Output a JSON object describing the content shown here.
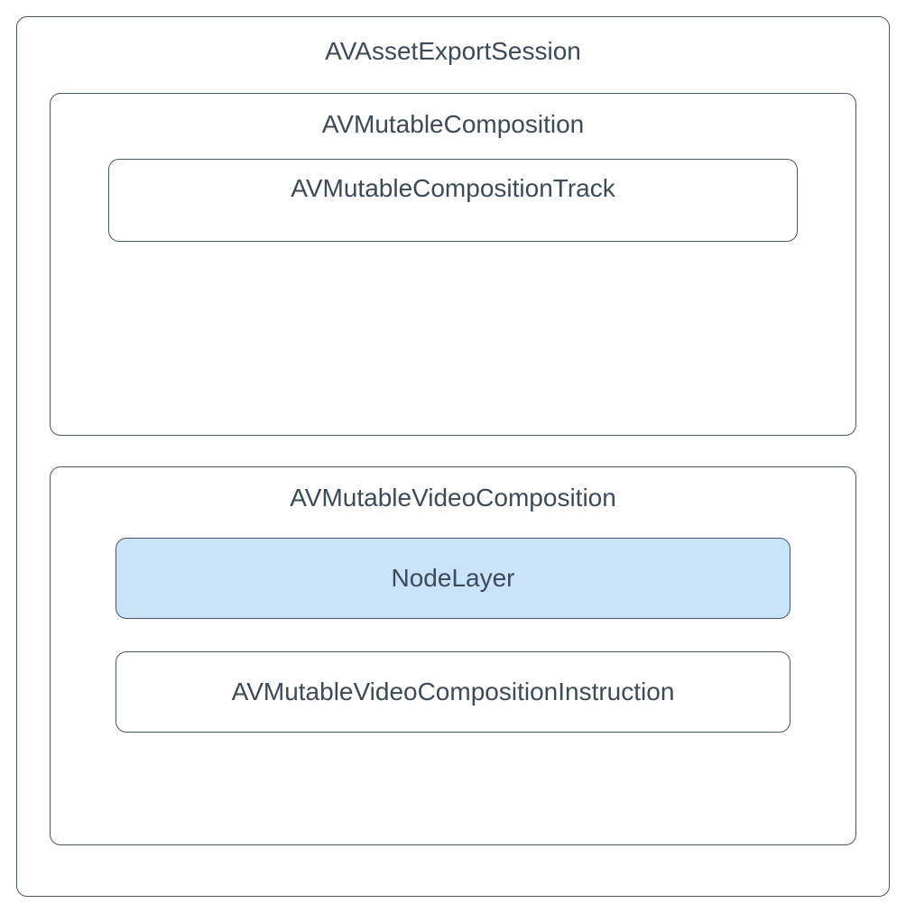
{
  "diagram": {
    "outer": {
      "title": "AVAssetExportSession"
    },
    "composition": {
      "title": "AVMutableComposition",
      "track": {
        "title": "AVMutableCompositionTrack"
      }
    },
    "videoComposition": {
      "title": "AVMutableVideoComposition",
      "nodeLayer": {
        "title": "NodeLayer",
        "highlighted": true,
        "highlightColor": "#c9e3f8"
      },
      "instruction": {
        "title": "AVMutableVideoCompositionInstruction"
      }
    }
  }
}
